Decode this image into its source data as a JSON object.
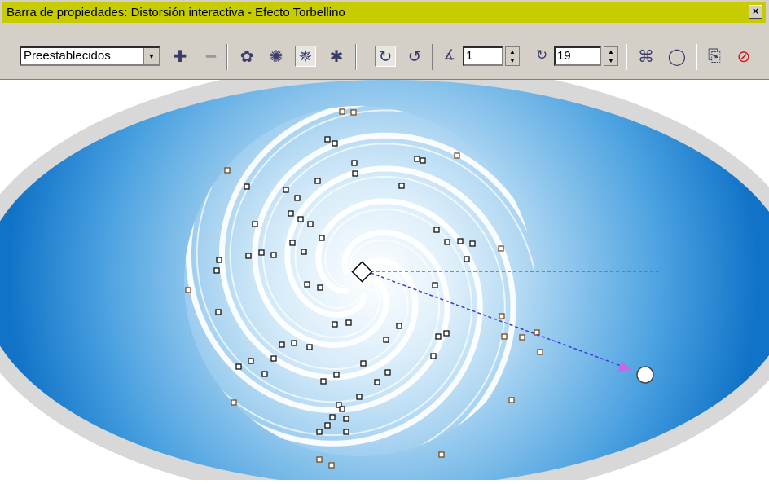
{
  "window": {
    "title": "Barra de propiedades: Distorsión interactiva - Efecto Torbellino",
    "close_label": "×"
  },
  "toolbar": {
    "preset_value": "Preestablecidos",
    "angle_value": "1",
    "rotations_value": "19",
    "icons": [
      "add-preset-icon",
      "remove-preset-icon",
      "push-pull-distortion-icon",
      "zipper-distortion-icon",
      "twister-distortion-icon",
      "roughen-distortion-icon",
      "clockwise-rotation-icon",
      "counterclockwise-rotation-icon",
      "additional-degrees-icon",
      "complete-rotations-icon",
      "center-distortion-icon",
      "convert-to-curves-icon",
      "copy-properties-icon",
      "clear-distortion-icon"
    ]
  },
  "colors": {
    "ellipse_edge": "#1b7fd2",
    "ellipse_center": "#ffffff",
    "outer_ring": "#d8d8d8",
    "title_bar": "#c7cc00",
    "arrow": "#9a4de0",
    "guide_line": "#3a3ae0"
  }
}
